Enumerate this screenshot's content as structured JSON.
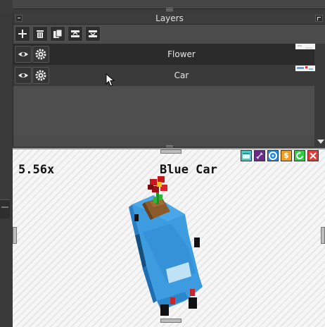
{
  "layers_panel": {
    "title": "Layers",
    "toolbar": [
      "add-layer",
      "delete-layer",
      "duplicate-layer",
      "merge-layer-up",
      "merge-layer-down"
    ],
    "layers": [
      {
        "name": "Flower",
        "selected": true
      },
      {
        "name": "Car",
        "selected": false
      }
    ]
  },
  "viewport": {
    "zoom": "5.56x",
    "scene_title": "Blue Car",
    "tools": [
      {
        "icon": "window-icon",
        "color": "#4fc7c9"
      },
      {
        "icon": "pin-icon",
        "color": "#6a2a8a"
      },
      {
        "icon": "target-icon",
        "color": "#1e88e5"
      },
      {
        "icon": "dollar-icon",
        "glyph": "$",
        "color": "#f0a020"
      },
      {
        "icon": "refresh-icon",
        "color": "#2ecc40"
      },
      {
        "icon": "close-icon",
        "color": "#e53935"
      }
    ]
  }
}
